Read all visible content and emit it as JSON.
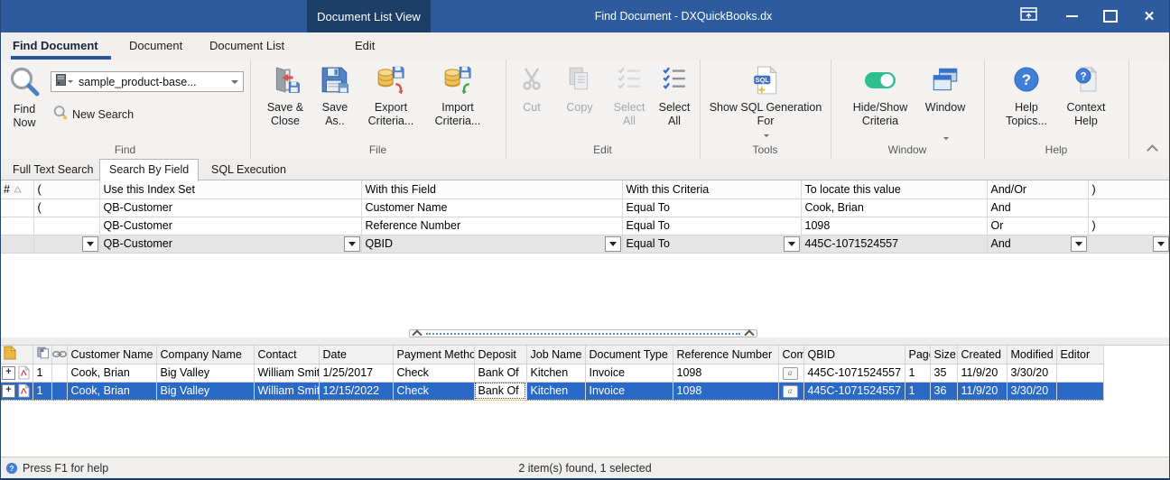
{
  "titlebar": {
    "view_tab": "Document List View",
    "title": "Find Document - DXQuickBooks.dx"
  },
  "ribbon": {
    "tabs": [
      "Find Document",
      "Document",
      "Document List",
      "Edit"
    ],
    "active_tab": "Find Document",
    "find": {
      "group_label": "Find",
      "combo_value": "sample_product-base...",
      "find_now": "Find Now",
      "new_search": "New Search"
    },
    "file": {
      "group_label": "File",
      "save_close": "Save & Close",
      "save_as": "Save As..",
      "export_criteria": "Export Criteria...",
      "import_criteria": "Import Criteria..."
    },
    "edit": {
      "group_label": "Edit",
      "cut": "Cut",
      "copy": "Copy",
      "select_all_disabled": "Select All",
      "select_all": "Select All"
    },
    "tools": {
      "group_label": "Tools",
      "show_sql": "Show SQL Generation For"
    },
    "window": {
      "group_label": "Window",
      "hide_show_criteria": "Hide/Show Criteria",
      "window_button": "Window"
    },
    "help": {
      "group_label": "Help",
      "help_topics": "Help Topics...",
      "context_help": "Context Help"
    }
  },
  "search_tabs": {
    "full_text": "Full Text Search",
    "by_field": "Search By Field",
    "sql": "SQL Execution",
    "active": "Search By Field"
  },
  "criteria": {
    "columns": {
      "num": "#",
      "open": "(",
      "index_set": "Use this Index Set",
      "field": "With this Field",
      "criteria": "With this Criteria",
      "value": "To locate this value",
      "andor": "And/Or",
      "close": ")"
    },
    "rows": [
      {
        "open": "(",
        "index_set": "QB-Customer",
        "field": "Customer Name",
        "criteria": "Equal To",
        "value": "Cook, Brian",
        "andor": "And",
        "close": ""
      },
      {
        "open": "",
        "index_set": "QB-Customer",
        "field": "Reference Number",
        "criteria": "Equal To",
        "value": "1098",
        "andor": "Or",
        "close": ")"
      },
      {
        "open": "",
        "index_set": "QB-Customer",
        "field": "QBID",
        "criteria": "Equal To",
        "value": "445C-1071524557",
        "andor": "And",
        "close": ""
      }
    ]
  },
  "results": {
    "columns": {
      "customer": "Customer Name",
      "company": "Company Name",
      "contact": "Contact",
      "date": "Date",
      "payment": "Payment Method",
      "deposit": "Deposit",
      "job": "Job Name",
      "doctype": "Document Type",
      "reference": "Reference Number",
      "comment": "Comment",
      "qbid": "QBID",
      "pages": "Pages",
      "size": "Size k",
      "created": "Created",
      "modified": "Modified",
      "editor": "Editor"
    },
    "rows": [
      {
        "copies": "1",
        "customer": "Cook, Brian",
        "company": "Big Valley",
        "contact": "William Smith",
        "date": "1/25/2017",
        "payment": "Check",
        "deposit": "Bank Of",
        "job": "Kitchen",
        "doctype": "Invoice",
        "reference": "1098",
        "qbid": "445C-1071524557",
        "pages": "1",
        "size": "35",
        "created": "11/9/20",
        "modified": "3/30/20",
        "editor": ""
      },
      {
        "copies": "1",
        "customer": "Cook, Brian",
        "company": "Big Valley",
        "contact": "William Smith",
        "date": "12/15/2022",
        "payment": "Check",
        "deposit": "Bank Of",
        "job": "Kitchen",
        "doctype": "Invoice",
        "reference": "1098",
        "qbid": "445C-1071524557",
        "pages": "1",
        "size": "36",
        "created": "11/9/20",
        "modified": "3/30/20",
        "editor": ""
      }
    ]
  },
  "statusbar": {
    "help_text": "Press F1 for help",
    "count_text": "2 item(s) found, 1 selected"
  },
  "glyphs": {
    "plus": "+",
    "close": "✕"
  },
  "colors": {
    "titlebar": "#2d5b9d",
    "view_tab": "#1d3e66",
    "accent": "#2a5699",
    "selection": "#2a69c5",
    "toggle_green": "#2fbf8f"
  }
}
